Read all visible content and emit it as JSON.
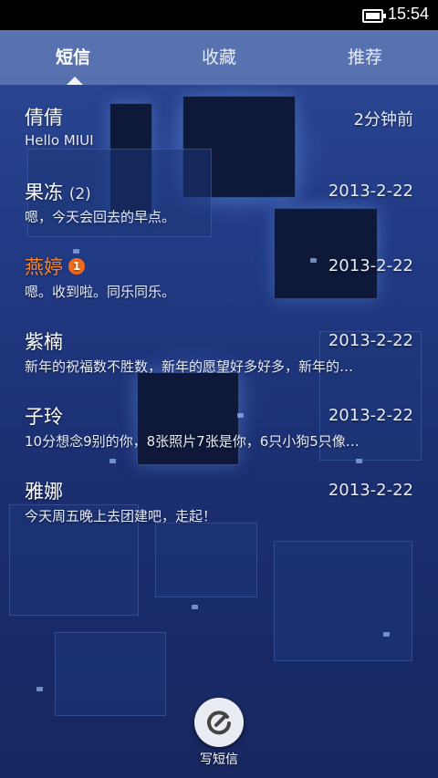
{
  "status_bar": {
    "time": "15:54",
    "battery_icon": "battery-full-icon"
  },
  "tabs": [
    {
      "label": "短信",
      "active": true
    },
    {
      "label": "收藏",
      "active": false
    },
    {
      "label": "推荐",
      "active": false
    }
  ],
  "conversations": [
    {
      "name": "倩倩",
      "count": "",
      "badge": "",
      "time": "2分钟前",
      "preview": "Hello MIUI",
      "unread": false
    },
    {
      "name": "果冻",
      "count": "(2)",
      "badge": "",
      "time": "2013-2-22",
      "preview": "嗯，今天会回去的早点。",
      "unread": false
    },
    {
      "name": "燕婷",
      "count": "",
      "badge": "1",
      "time": "2013-2-22",
      "preview": "嗯。收到啦。同乐同乐。",
      "unread": true
    },
    {
      "name": "紫楠",
      "count": "",
      "badge": "",
      "time": "2013-2-22",
      "preview": "新年的祝福数不胜数，新年的愿望好多好多，新年的…",
      "unread": false
    },
    {
      "name": "子玲",
      "count": "",
      "badge": "",
      "time": "2013-2-22",
      "preview": "10分想念9别的你，8张照片7张是你，6只小狗5只像…",
      "unread": false
    },
    {
      "name": "雅娜",
      "count": "",
      "badge": "",
      "time": "2013-2-22",
      "preview": "今天周五晚上去团建吧，走起！",
      "unread": false
    }
  ],
  "compose": {
    "label": "写短信",
    "icon": "compose-message-icon"
  },
  "colors": {
    "accent_unread": "#f2842f",
    "badge": "#f26a1b"
  }
}
